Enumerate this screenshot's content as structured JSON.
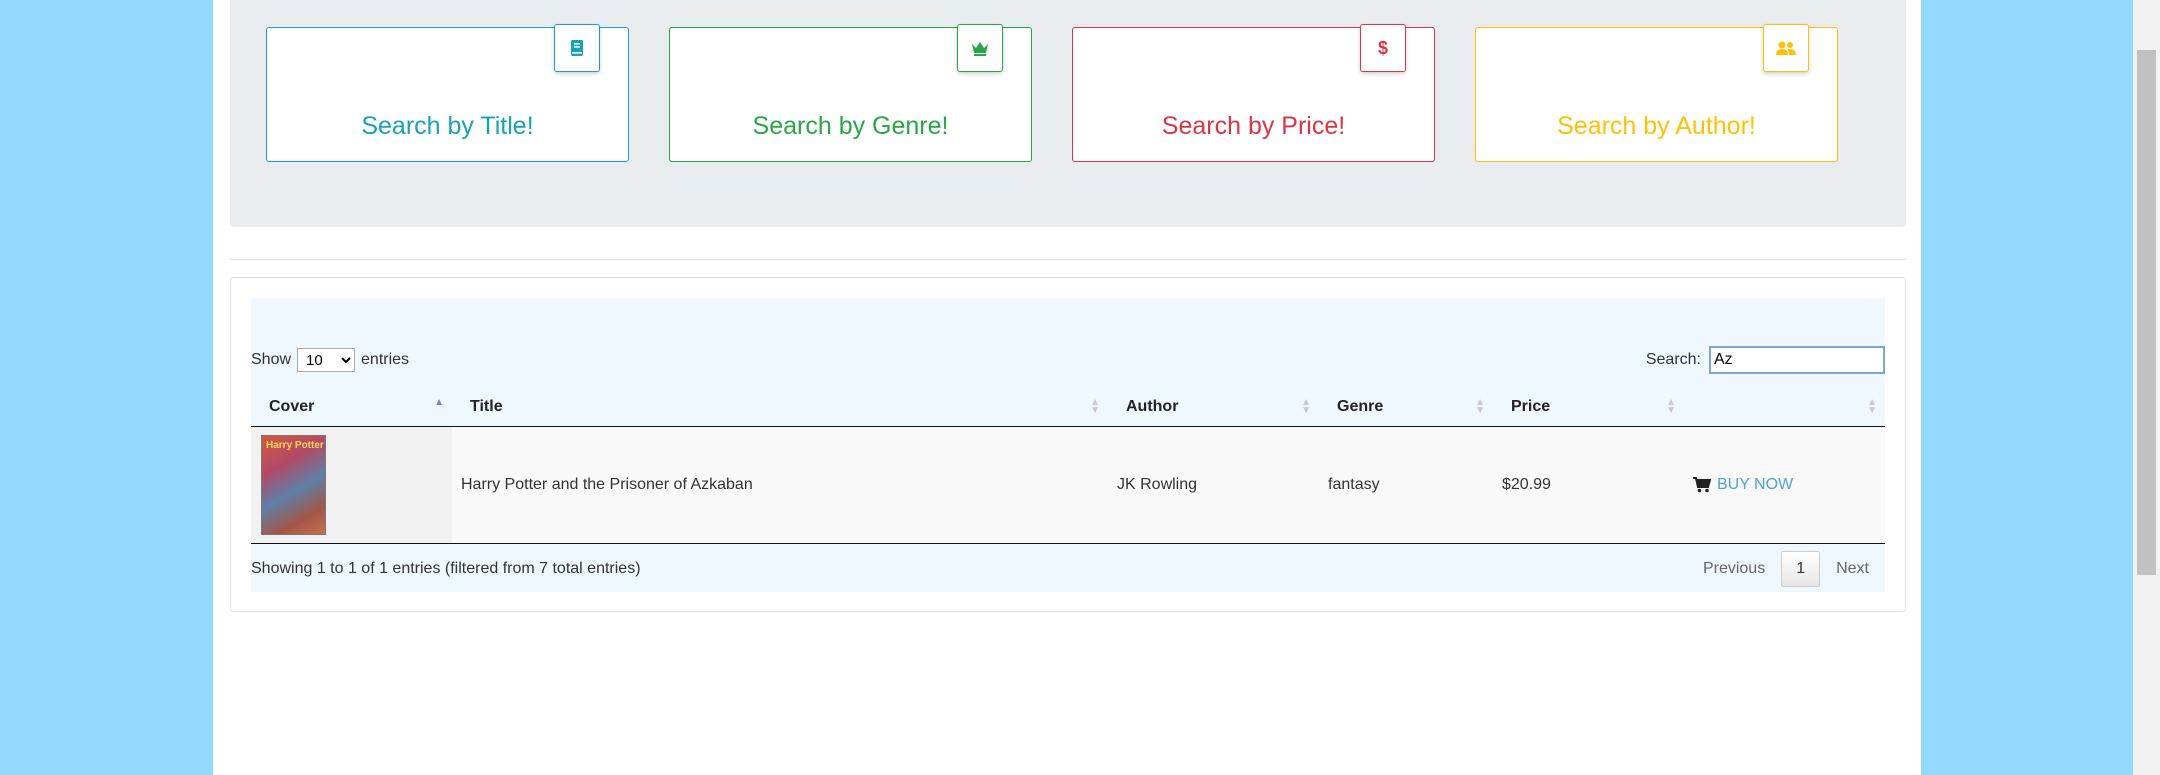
{
  "search_cards": [
    {
      "label": "Search by Title!",
      "icon": "book-icon",
      "color": "#17a2b8"
    },
    {
      "label": "Search by Genre!",
      "icon": "crown-icon",
      "color": "#28a745"
    },
    {
      "label": "Search by Price!",
      "icon": "dollar-icon",
      "color": "#dc3545"
    },
    {
      "label": "Search by Author!",
      "icon": "users-icon",
      "color": "#ffc107"
    }
  ],
  "table": {
    "length_prefix": "Show",
    "length_value": "10",
    "length_suffix": "entries",
    "search_label": "Search:",
    "search_value": "Az",
    "columns": [
      "Cover",
      "Title",
      "Author",
      "Genre",
      "Price",
      ""
    ],
    "rows": [
      {
        "cover": "book-cover-image",
        "cover_text": "Harry Potter",
        "title": "Harry Potter and the Prisoner of Azkaban",
        "author": "JK Rowling",
        "genre": "fantasy",
        "price": "$20.99",
        "action": "BUY NOW"
      }
    ],
    "info": "Showing 1 to 1 of 1 entries (filtered from 7 total entries)",
    "pagination": {
      "previous": "Previous",
      "current": "1",
      "next": "Next"
    }
  },
  "colors": {
    "page_background": "#92d9ff",
    "link": "#4fa3d1"
  }
}
